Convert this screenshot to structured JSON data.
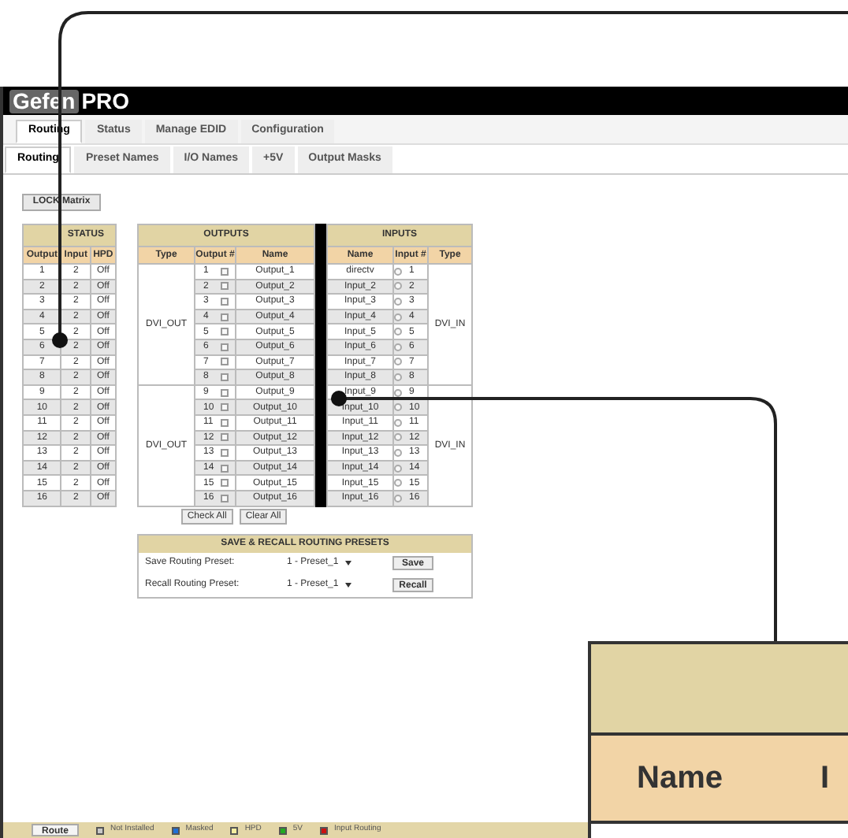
{
  "header": {
    "logo_left": "Gefen",
    "logo_right": "PRO"
  },
  "main_tabs": [
    {
      "label": "Routing",
      "selected": true
    },
    {
      "label": "Status",
      "selected": false
    },
    {
      "label": "Manage EDID",
      "selected": false
    },
    {
      "label": "Configuration",
      "selected": false
    }
  ],
  "sub_tabs": [
    {
      "label": "Routing",
      "selected": true
    },
    {
      "label": "Preset Names",
      "selected": false
    },
    {
      "label": "I/O Names",
      "selected": false
    },
    {
      "label": "+5V",
      "selected": false
    },
    {
      "label": "Output Masks",
      "selected": false
    }
  ],
  "lock_button": "LOCK Matrix",
  "status_table": {
    "title": "STATUS",
    "columns": [
      "Output",
      "Input",
      "HPD"
    ],
    "rows": [
      [
        "1",
        "2",
        "Off"
      ],
      [
        "2",
        "2",
        "Off"
      ],
      [
        "3",
        "2",
        "Off"
      ],
      [
        "4",
        "2",
        "Off"
      ],
      [
        "5",
        "2",
        "Off"
      ],
      [
        "6",
        "2",
        "Off"
      ],
      [
        "7",
        "2",
        "Off"
      ],
      [
        "8",
        "2",
        "Off"
      ],
      [
        "9",
        "2",
        "Off"
      ],
      [
        "10",
        "2",
        "Off"
      ],
      [
        "11",
        "2",
        "Off"
      ],
      [
        "12",
        "2",
        "Off"
      ],
      [
        "13",
        "2",
        "Off"
      ],
      [
        "14",
        "2",
        "Off"
      ],
      [
        "15",
        "2",
        "Off"
      ],
      [
        "16",
        "2",
        "Off"
      ]
    ]
  },
  "outputs_table": {
    "title": "OUTPUTS",
    "columns": [
      "Type",
      "Output #",
      "Name"
    ],
    "groups": [
      {
        "type": "DVI_OUT",
        "rows": [
          {
            "number": "1",
            "name": "Output_1",
            "checked": false
          },
          {
            "number": "2",
            "name": "Output_2",
            "checked": false
          },
          {
            "number": "3",
            "name": "Output_3",
            "checked": false
          },
          {
            "number": "4",
            "name": "Output_4",
            "checked": false
          },
          {
            "number": "5",
            "name": "Output_5",
            "checked": false
          },
          {
            "number": "6",
            "name": "Output_6",
            "checked": false
          },
          {
            "number": "7",
            "name": "Output_7",
            "checked": false
          },
          {
            "number": "8",
            "name": "Output_8",
            "checked": false
          }
        ]
      },
      {
        "type": "DVI_OUT",
        "rows": [
          {
            "number": "9",
            "name": "Output_9",
            "checked": false
          },
          {
            "number": "10",
            "name": "Output_10",
            "checked": false
          },
          {
            "number": "11",
            "name": "Output_11",
            "checked": false
          },
          {
            "number": "12",
            "name": "Output_12",
            "checked": false
          },
          {
            "number": "13",
            "name": "Output_13",
            "checked": false
          },
          {
            "number": "14",
            "name": "Output_14",
            "checked": false
          },
          {
            "number": "15",
            "name": "Output_15",
            "checked": false
          },
          {
            "number": "16",
            "name": "Output_16",
            "checked": false
          }
        ]
      }
    ]
  },
  "inputs_table": {
    "title": "INPUTS",
    "columns": [
      "Name",
      "Input #",
      "Type"
    ],
    "groups": [
      {
        "type": "DVI_IN",
        "rows": [
          {
            "name": "directv",
            "number": "1",
            "selected": false
          },
          {
            "name": "Input_2",
            "number": "2",
            "selected": false
          },
          {
            "name": "Input_3",
            "number": "3",
            "selected": false
          },
          {
            "name": "Input_4",
            "number": "4",
            "selected": false
          },
          {
            "name": "Input_5",
            "number": "5",
            "selected": false
          },
          {
            "name": "Input_6",
            "number": "6",
            "selected": false
          },
          {
            "name": "Input_7",
            "number": "7",
            "selected": false
          },
          {
            "name": "Input_8",
            "number": "8",
            "selected": false
          }
        ]
      },
      {
        "type": "DVI_IN",
        "rows": [
          {
            "name": "Input_9",
            "number": "9",
            "selected": false
          },
          {
            "name": "Input_10",
            "number": "10",
            "selected": false
          },
          {
            "name": "Input_11",
            "number": "11",
            "selected": false
          },
          {
            "name": "Input_12",
            "number": "12",
            "selected": false
          },
          {
            "name": "Input_13",
            "number": "13",
            "selected": false
          },
          {
            "name": "Input_14",
            "number": "14",
            "selected": false
          },
          {
            "name": "Input_15",
            "number": "15",
            "selected": false
          },
          {
            "name": "Input_16",
            "number": "16",
            "selected": false
          }
        ]
      }
    ]
  },
  "output_buttons": [
    "Check All",
    "Clear All"
  ],
  "presets": {
    "title": "SAVE & RECALL ROUTING PRESETS",
    "rows": [
      {
        "label": "Save Routing Preset:",
        "value": "1 - Preset_1",
        "button": "Save"
      },
      {
        "label": "Recall Routing Preset:",
        "value": "1 - Preset_1",
        "button": "Recall"
      }
    ]
  },
  "footer": {
    "button": "Route",
    "legend": [
      {
        "label": "Not Installed",
        "color": "#c8c8c8"
      },
      {
        "label": "Masked",
        "color": "#1f6fd6"
      },
      {
        "label": "HPD",
        "color": "#f5eea0"
      },
      {
        "label": "5V",
        "color": "#22aa22"
      },
      {
        "label": "Input Routing",
        "color": "#cc1111"
      }
    ]
  },
  "inset": {
    "columns": [
      "Name",
      "I"
    ]
  }
}
